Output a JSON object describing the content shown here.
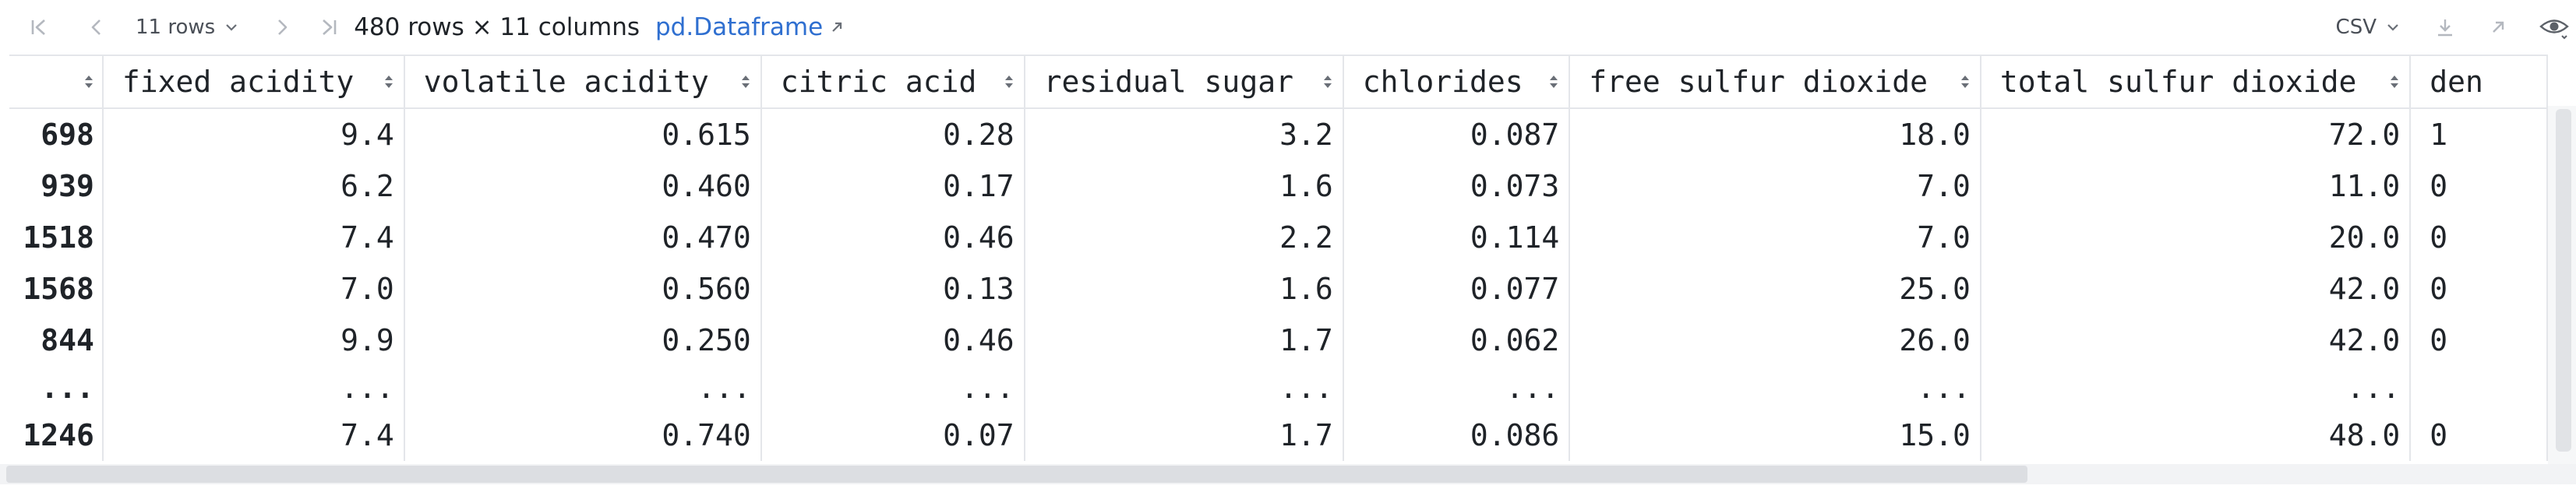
{
  "toolbar": {
    "rows_select": "11 rows",
    "summary": "480 rows × 11 columns",
    "link_label": "pd.Dataframe",
    "export_format": "CSV"
  },
  "table": {
    "columns": [
      "fixed acidity",
      "volatile acidity",
      "citric acid",
      "residual sugar",
      "chlorides",
      "free sulfur dioxide",
      "total sulfur dioxide",
      "den"
    ],
    "rows": [
      {
        "index": "698",
        "cells": [
          "9.4",
          "0.615",
          "0.28",
          "3.2",
          "0.087",
          "18.0",
          "72.0",
          "1"
        ]
      },
      {
        "index": "939",
        "cells": [
          "6.2",
          "0.460",
          "0.17",
          "1.6",
          "0.073",
          "7.0",
          "11.0",
          "0"
        ]
      },
      {
        "index": "1518",
        "cells": [
          "7.4",
          "0.470",
          "0.46",
          "2.2",
          "0.114",
          "7.0",
          "20.0",
          "0"
        ]
      },
      {
        "index": "1568",
        "cells": [
          "7.0",
          "0.560",
          "0.13",
          "1.6",
          "0.077",
          "25.0",
          "42.0",
          "0"
        ]
      },
      {
        "index": "844",
        "cells": [
          "9.9",
          "0.250",
          "0.46",
          "1.7",
          "0.062",
          "26.0",
          "42.0",
          "0"
        ]
      },
      {
        "index": "...",
        "cells": [
          "...",
          "...",
          "...",
          "...",
          "...",
          "...",
          "...",
          ""
        ]
      },
      {
        "index": "1246",
        "cells": [
          "7.4",
          "0.740",
          "0.07",
          "1.7",
          "0.086",
          "15.0",
          "48.0",
          "0"
        ]
      }
    ]
  },
  "icons": {
    "first": "first-page-icon",
    "prev": "previous-page-icon",
    "next": "next-page-icon",
    "last": "last-page-icon",
    "download": "download-icon",
    "open": "open-in-new-icon",
    "view": "eye-icon",
    "sort": "sort-icon"
  },
  "colors": {
    "link": "#2f6fd0",
    "grid": "#e4e6ea",
    "text": "#1f2328",
    "icon_disabled": "#b4b8bf"
  }
}
